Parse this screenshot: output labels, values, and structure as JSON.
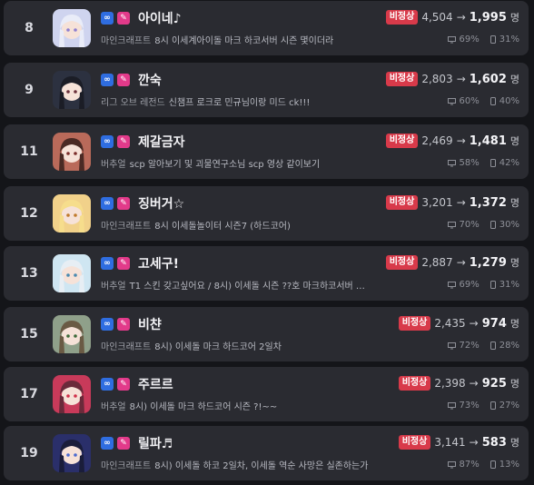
{
  "colors": {
    "background": "#141519",
    "card": "#2a2b31",
    "alert": "#d83a4a",
    "infinity_badge": "#2f6de0",
    "pen_badge": "#e23a8a"
  },
  "icons": {
    "platform_badge": "infinity-icon",
    "partner_badge": "pen-icon",
    "pc_share": "monitor-icon",
    "mobile_share": "phone-icon"
  },
  "unit": "명",
  "arrow": "→",
  "alert_label": "비정상",
  "streamers": [
    {
      "rank": "8",
      "name": "아이네♪",
      "category": "마인크래프트",
      "title": "8시 이세계아이돌 마크 하코서버 시즌 몇이더라",
      "viewers_from": "4,504",
      "viewers_to": "1,995",
      "pc_share": "69%",
      "mobile_share": "31%"
    },
    {
      "rank": "9",
      "name": "깐숙",
      "category": "리그 오브 레전드",
      "title": "신챔프 로크로 민규님이랑 미드 ck!!!",
      "viewers_from": "2,803",
      "viewers_to": "1,602",
      "pc_share": "60%",
      "mobile_share": "40%"
    },
    {
      "rank": "11",
      "name": "제갈금자",
      "category": "버추얼",
      "title": "scp 알아보기 및 괴물연구소님 scp 영상 같이보기",
      "viewers_from": "2,469",
      "viewers_to": "1,481",
      "pc_share": "58%",
      "mobile_share": "42%"
    },
    {
      "rank": "12",
      "name": "징버거☆",
      "category": "마인크래프트",
      "title": "8시 이세돌놀이터 시즌7 (하드코어)",
      "viewers_from": "3,201",
      "viewers_to": "1,372",
      "pc_share": "70%",
      "mobile_share": "30%"
    },
    {
      "rank": "13",
      "name": "고세구!",
      "category": "버추얼",
      "title": "T1 스킨 갖고싶어요 / 8시) 이세돌 시즌 ??호 마크하코서버 …",
      "viewers_from": "2,887",
      "viewers_to": "1,279",
      "pc_share": "69%",
      "mobile_share": "31%"
    },
    {
      "rank": "15",
      "name": "비챤",
      "category": "마인크래프트",
      "title": "8시) 이세돌 마크 하드코어 2일차",
      "viewers_from": "2,435",
      "viewers_to": "974",
      "pc_share": "72%",
      "mobile_share": "28%"
    },
    {
      "rank": "17",
      "name": "주르르",
      "category": "버추얼",
      "title": "8시) 이세돌 마크 하드코어 시즌 ?!~~",
      "viewers_from": "2,398",
      "viewers_to": "925",
      "pc_share": "73%",
      "mobile_share": "27%"
    },
    {
      "rank": "19",
      "name": "릴파♬",
      "category": "마인크래프트",
      "title": "8시) 이세돌 하코 2일차, 이세돌 역순 사망은 실존하는가",
      "viewers_from": "3,141",
      "viewers_to": "583",
      "pc_share": "87%",
      "mobile_share": "13%"
    }
  ]
}
